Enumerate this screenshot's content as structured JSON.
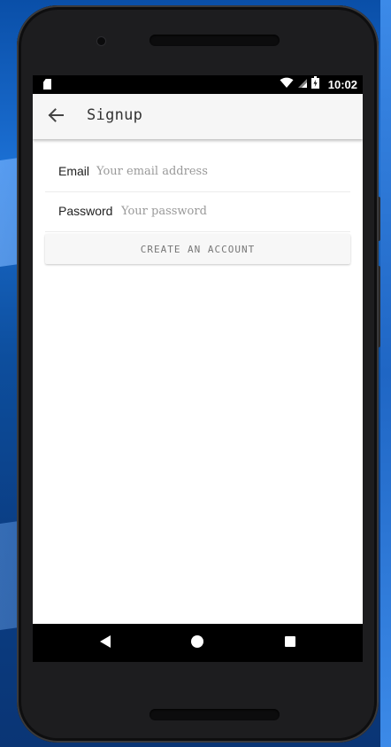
{
  "status_bar": {
    "time": "10:02",
    "icons": [
      "sd-card-icon",
      "wifi-icon",
      "cell-signal-icon",
      "battery-icon"
    ]
  },
  "app_bar": {
    "title": "Signup",
    "back_icon": "arrow-back-icon"
  },
  "form": {
    "email": {
      "label": "Email",
      "placeholder": "Your email address",
      "value": ""
    },
    "password": {
      "label": "Password",
      "placeholder": "Your password",
      "value": ""
    },
    "submit_label": "CREATE AN ACCOUNT"
  },
  "nav_bar": {
    "icons": [
      "nav-back-icon",
      "nav-home-icon",
      "nav-recent-apps-icon"
    ]
  },
  "colors": {
    "app_bar_bg": "#f6f6f6",
    "status_bar_bg": "#000000",
    "screen_bg": "#ffffff",
    "wallpaper": "#0d4e9d"
  }
}
